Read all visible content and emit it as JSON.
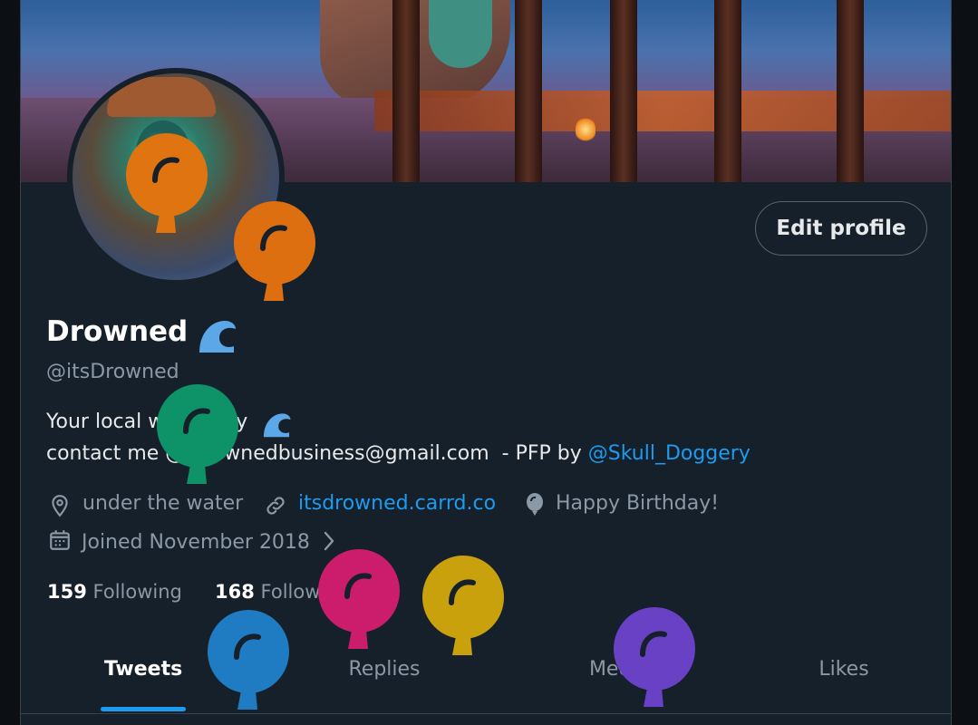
{
  "profile": {
    "display_name": "Drowned",
    "handle": "@itsDrowned",
    "edit_button_label": "Edit profile",
    "bio_line1": "Your local water boy",
    "bio_line2_prefix": "contact me @ drownedbusiness@gmail.com  - PFP by ",
    "bio_mention": "@Skull_Doggery",
    "name_emoji": "wave-icon"
  },
  "meta": {
    "location": "under the water",
    "website": "itsdrowned.carrd.co",
    "birthday": "Happy Birthday!",
    "joined": "Joined November 2018"
  },
  "stats": {
    "following_count": "159",
    "following_label": "Following",
    "followers_count": "168",
    "followers_label": "Followers"
  },
  "tabs": [
    {
      "label": "Tweets",
      "active": true
    },
    {
      "label": "Replies",
      "active": false
    },
    {
      "label": "Media",
      "active": false
    },
    {
      "label": "Likes",
      "active": false
    }
  ],
  "balloon_colors": [
    "#e07411",
    "#de6f11",
    "#0e9268",
    "#cc1c6c",
    "#c9a10c",
    "#1f7bc2",
    "#6941c4"
  ],
  "colors": {
    "accent": "#1d9bf0",
    "background": "#15202b",
    "secondary_text": "#8b98a5"
  }
}
